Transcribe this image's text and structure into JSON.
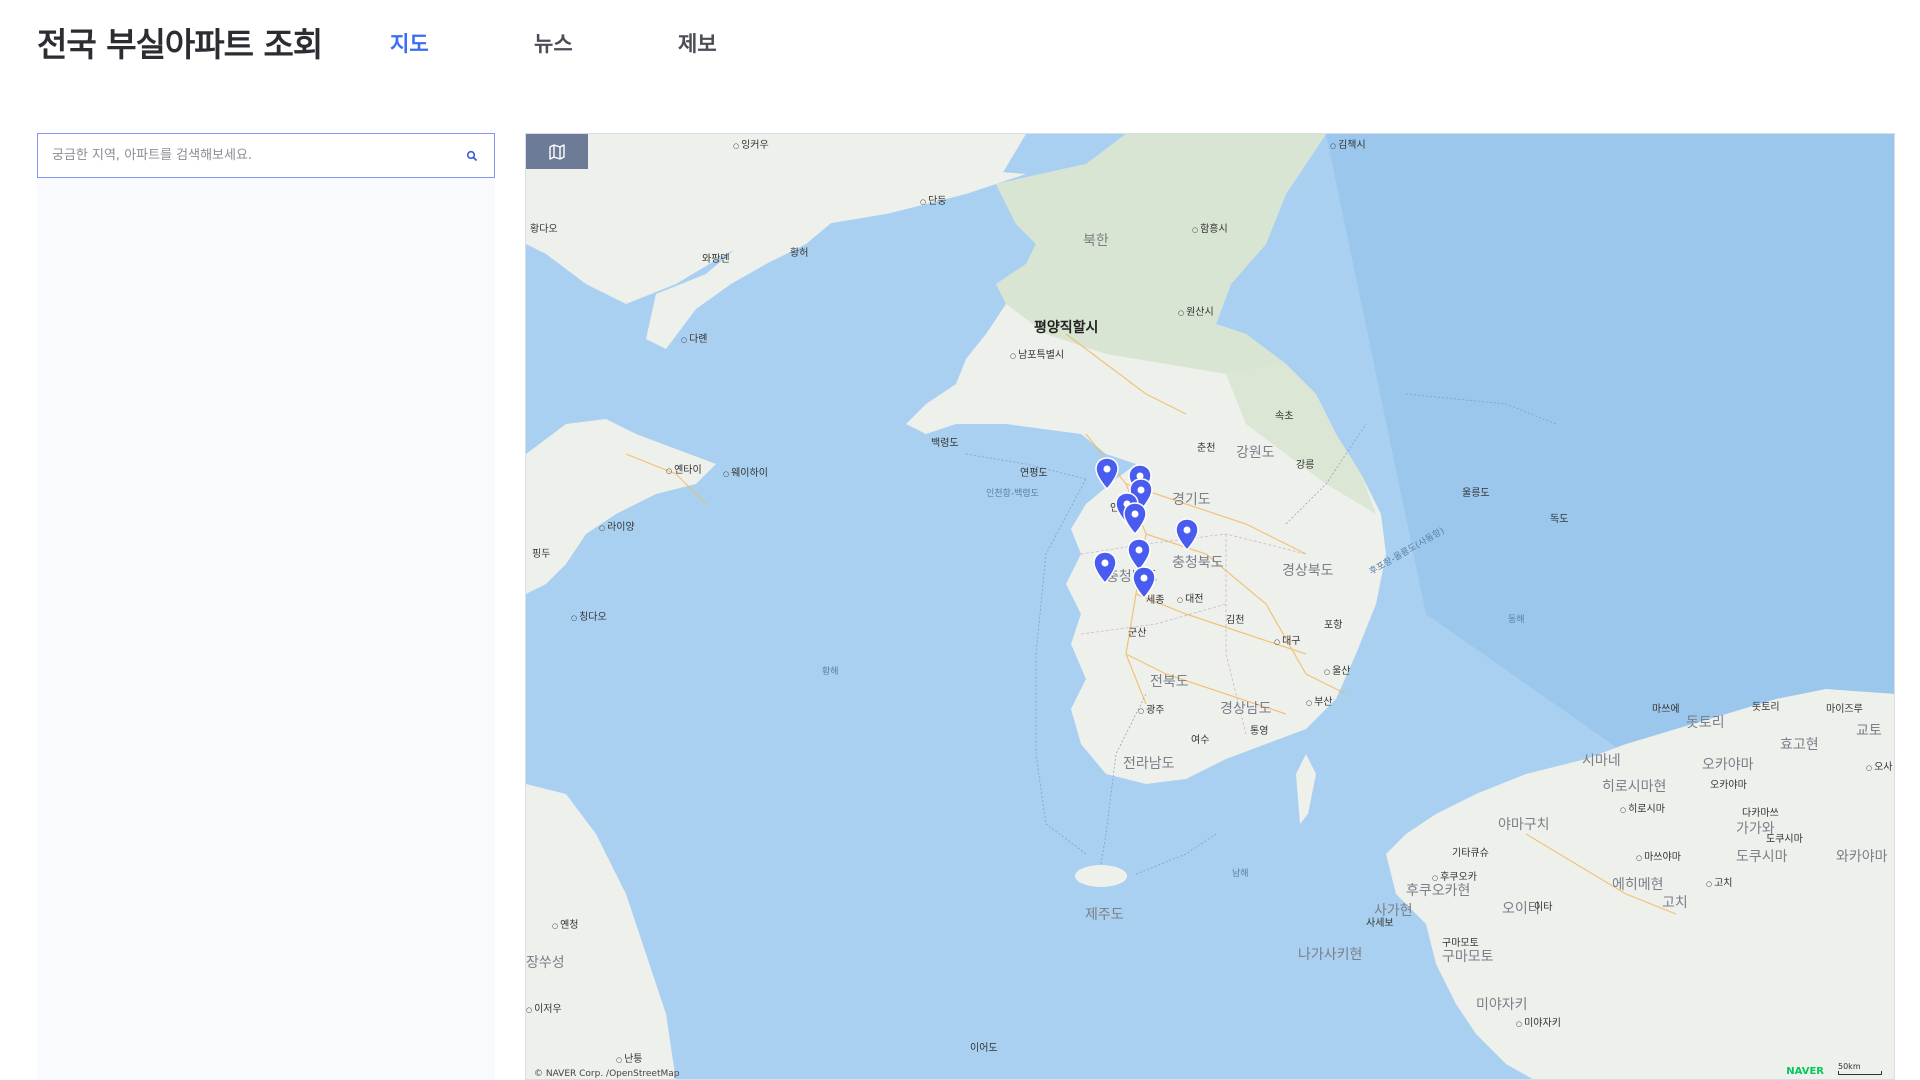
{
  "header": {
    "logo": "전국 부실아파트 조회",
    "nav": [
      {
        "label": "지도",
        "active": true
      },
      {
        "label": "뉴스",
        "active": false
      },
      {
        "label": "제보",
        "active": false
      }
    ]
  },
  "sidebar": {
    "search": {
      "placeholder": "궁금한 지역, 아파트를 검색해보세요.",
      "value": ""
    }
  },
  "map": {
    "labels": {
      "ingkou": "잉커우",
      "dandong": "단둥",
      "hwangdao": "황다오",
      "wafangdian": "와팡뎬",
      "hwangho": "황허",
      "dalian": "다롄",
      "bukhan": "북한",
      "pyongyang": "평양직할시",
      "nampo": "남포특별시",
      "hamhung": "함흥시",
      "wonsan": "원산시",
      "kimchaek": "김책시",
      "sokcho": "속초",
      "chuncheon": "춘천",
      "gangwon": "강원도",
      "gangneung": "강릉",
      "ulleung": "울릉도",
      "dokdo": "독도",
      "baengnyeong": "백령도",
      "yeonpyeong": "연평도",
      "incheon_baengnyeong": "인천항-백령도",
      "incheon": "인천",
      "gyeonggi": "경기도",
      "chungbuk": "충청북도",
      "chungnam": "충청남도",
      "gyeongbuk": "경상북도",
      "sejong": "세종",
      "daejeon": "대전",
      "gimcheon": "김천",
      "pohang": "포항",
      "daegu": "대구",
      "gunsan": "군산",
      "jeonbuk": "전북도",
      "gyeongnam": "경상남도",
      "ulsan": "울산",
      "busan": "부산",
      "gwangju": "광주",
      "jeonnam": "전라남도",
      "yeosu": "여수",
      "tongyeong": "통영",
      "jeju": "제주도",
      "ieodo": "이어도",
      "yantai": "옌타이",
      "weihai": "웨이하이",
      "laiyang": "라이양",
      "pingdu": "핑두",
      "qingdao": "칭다오",
      "hwanghae": "황해",
      "donghae": "동해",
      "namhae": "남해",
      "yancheng": "옌청",
      "jiangsu": "장쑤성",
      "lianyungang": "이저우",
      "nantong": "난퉁",
      "hupo_ulleung": "후포항-울릉도(사동항)",
      "masue": "마쓰에",
      "dottori": "돗토리",
      "dottori_pref": "돗토리",
      "hyogo": "효고현",
      "kyoto": "교토",
      "maizuru": "마이즈루",
      "osaka": "오사",
      "shimane": "시마네",
      "okayama_pref": "오카야마",
      "okayama": "오카야마",
      "hiroshima_pref": "히로시마현",
      "hiroshima": "히로시마",
      "takamatsu": "다카마쓰",
      "kagawa": "가가와",
      "tokushima": "도쿠시마",
      "tokushima_pref": "도쿠시마",
      "wakayama": "와카야마",
      "yamaguchi": "야마구치",
      "matsuyama": "마쓰야마",
      "ehime": "에히메현",
      "kochi": "고치",
      "kochi_city": "고치",
      "kitakyushu": "기타큐슈",
      "fukuoka": "후쿠오카",
      "fukuoka_pref": "후쿠오카현",
      "saga": "사가현",
      "oita": "오이타",
      "oita_city": "이타",
      "sasebo": "사세보",
      "nagasaki": "나가사키현",
      "kumamoto": "구마모토",
      "kumamoto_pref": "구마모토",
      "miyazaki_pref": "미야자키",
      "miyazaki": "미야자키",
      "copyright": "© NAVER Corp. /OpenStreetMap",
      "naver": "NAVER",
      "scale": "50km"
    },
    "marker_count": 11
  },
  "colors": {
    "accent": "#3b6cf5",
    "marker": "#4a5cf0",
    "sea": "#a8cff0",
    "land": "#eef0ec"
  }
}
